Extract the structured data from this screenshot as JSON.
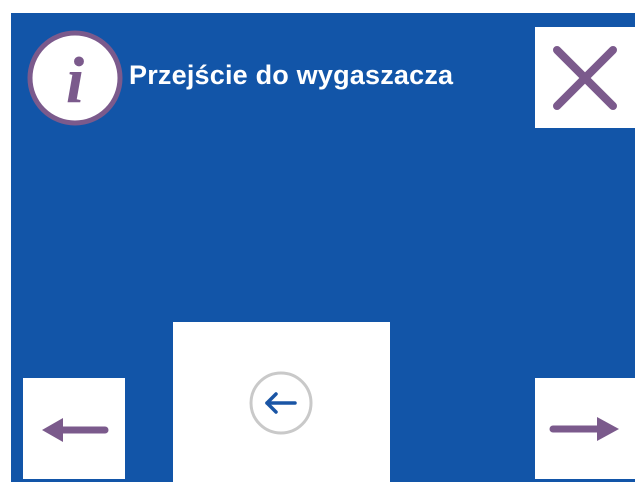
{
  "dialog": {
    "title": "Przejście do wygaszacza",
    "info_icon_glyph": "i"
  },
  "buttons": {
    "close": {
      "icon": "close-icon"
    },
    "back": {
      "icon": "back-arrow-circle-icon"
    },
    "prev": {
      "icon": "arrow-left-icon"
    },
    "next": {
      "icon": "arrow-right-icon"
    }
  },
  "colors": {
    "background": "#1255a8",
    "accent": "#7b5a8c",
    "button_bg": "#ffffff"
  }
}
